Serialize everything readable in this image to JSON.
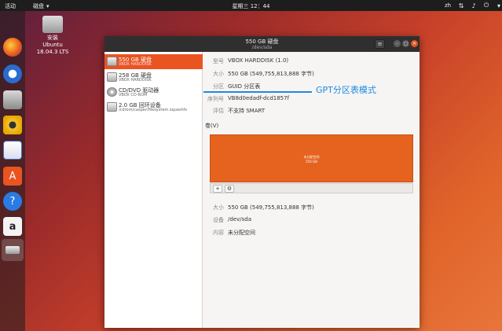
{
  "topbar": {
    "activities": "活动",
    "app_menu": "磁盘",
    "clock": "星期三 12：44",
    "lang": "zh"
  },
  "desktop": {
    "icon_label_1": "安装",
    "icon_label_2": "Ubuntu",
    "icon_label_3": "18.04.3 LTS"
  },
  "dock": {
    "items": [
      "firefox",
      "thunderbird",
      "files",
      "rhythmbox",
      "libreoffice-writer",
      "software-center",
      "help",
      "amazon",
      "disks"
    ]
  },
  "window": {
    "title": "550 GB 硬盘",
    "subtitle": "/dev/sda",
    "menu_glyph": "≡"
  },
  "sidebar": {
    "items": [
      {
        "name": "550 GB 硬盘",
        "sub": "VBOX HARDDISK"
      },
      {
        "name": "258 GB 硬盘",
        "sub": "VBOX HARDDISK"
      },
      {
        "name": "CD/DVD 驱动器",
        "sub": "VBOX CD-ROM"
      },
      {
        "name": "2.0 GB 回环设备",
        "sub": "/cdrom/casper/filesystem.squashfs"
      }
    ]
  },
  "details": {
    "model_label": "型号",
    "model_value": "VBOX HARDDISK (1.0)",
    "size_label": "大小",
    "size_value": "550 GB (549,755,813,888 字节)",
    "partition_label": "分区",
    "partition_value": "GUID 分区表",
    "serial_label": "序列号",
    "serial_value": "VB8d0edadf-dcd1857f",
    "assess_label": "评估",
    "assess_value": "不支持 SMART"
  },
  "volumes": {
    "label": "卷(V)",
    "bar_line1": "未分配空间",
    "bar_line2": "550 GB",
    "add_glyph": "+",
    "config_glyph": "⚙",
    "size_label": "大小",
    "size_value": "550 GB (549,755,813,888 字节)",
    "device_label": "设备",
    "device_value": "/dev/sda",
    "content_label": "内容",
    "content_value": "未分配空间"
  },
  "annotation": {
    "text": "GPT分区表模式",
    "color": "#1e8ae0"
  }
}
